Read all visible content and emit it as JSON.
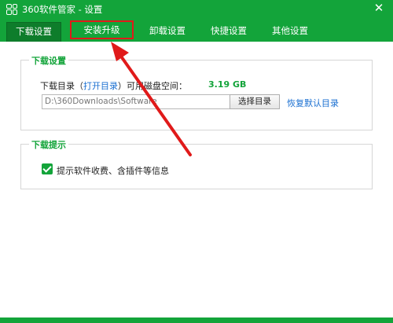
{
  "window": {
    "title": "360软件管家 - 设置",
    "close": "✕"
  },
  "tabs": [
    {
      "label": "下载设置"
    },
    {
      "label": "安装升级"
    },
    {
      "label": "卸载设置"
    },
    {
      "label": "快捷设置"
    },
    {
      "label": "其他设置"
    }
  ],
  "download_settings": {
    "title": "下载设置",
    "dir_label": "下载目录（",
    "open_dir": "打开目录",
    "free_space_label": "）可用磁盘空间：",
    "free_space_value": "3.19 GB",
    "path_value": "D:\\360Downloads\\Software",
    "choose_button": "选择目录",
    "restore_default": "恢复默认目录"
  },
  "download_tips": {
    "title": "下载提示",
    "checkbox_label": "提示软件收费、含插件等信息",
    "checked": true
  },
  "colors": {
    "accent": "#13a43a",
    "highlight": "#e01a1a",
    "link": "#1a6fd1"
  }
}
